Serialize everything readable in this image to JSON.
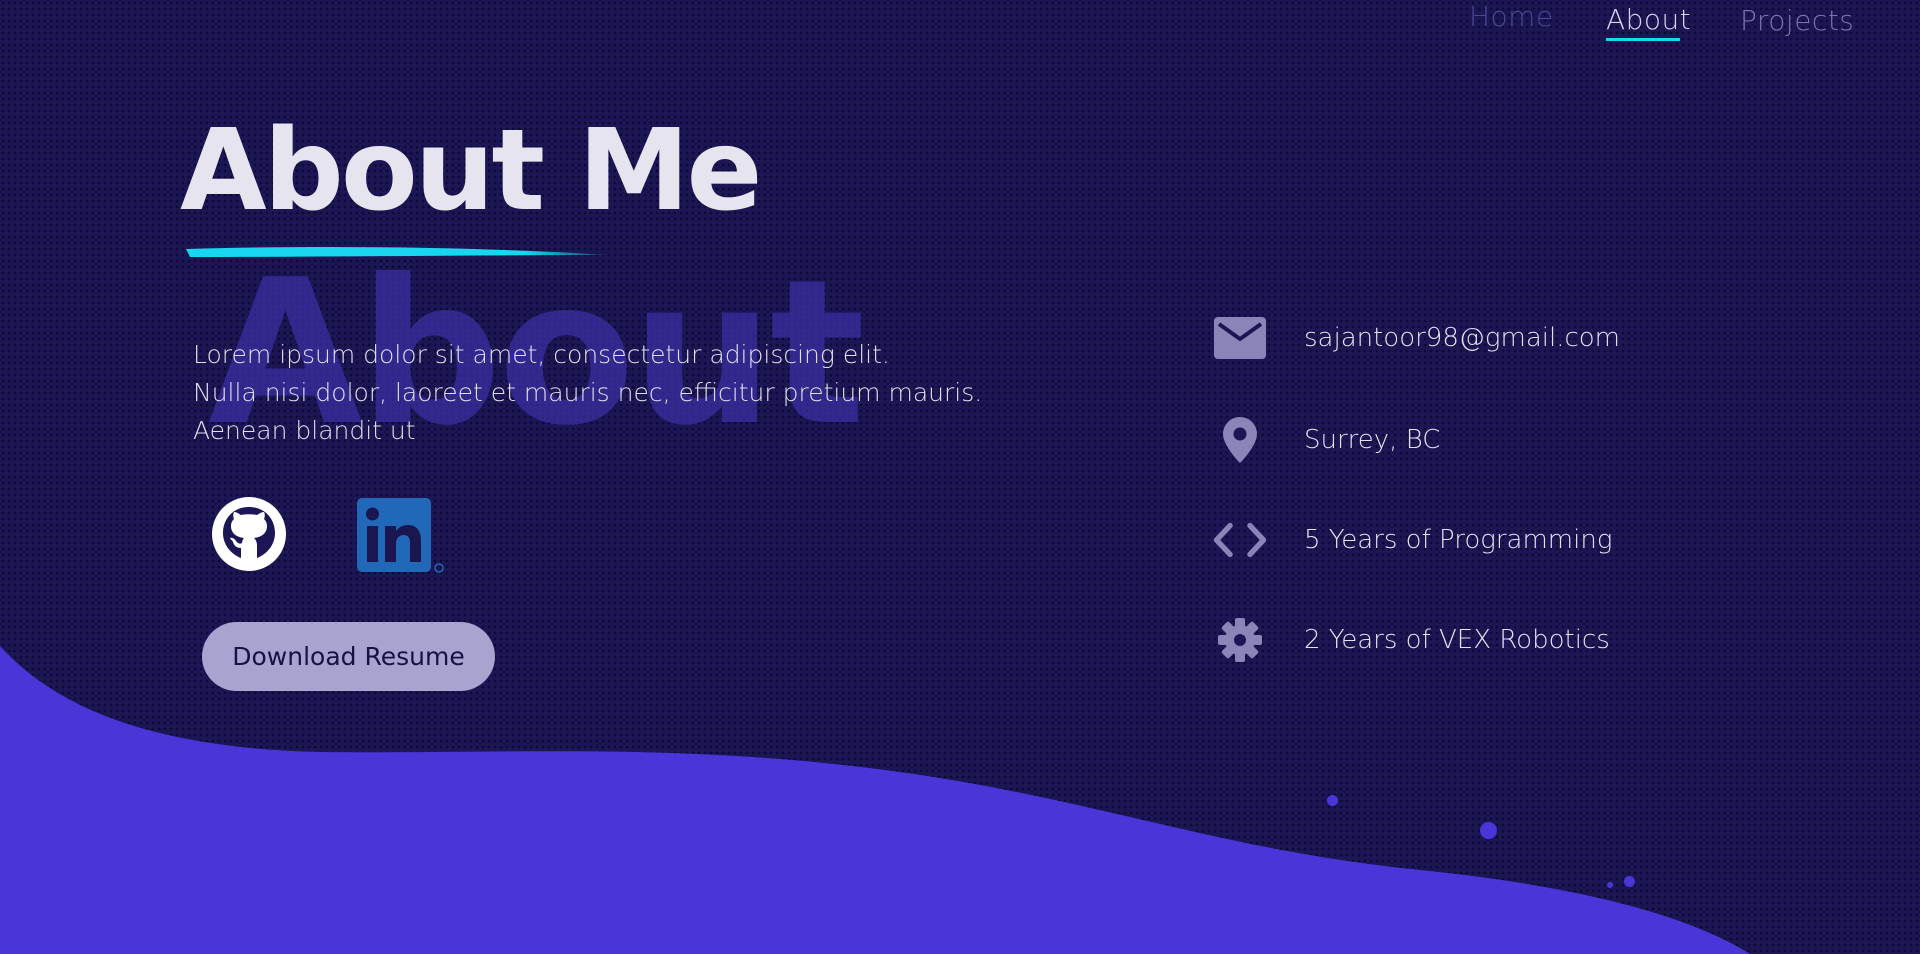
{
  "nav": {
    "items": [
      {
        "label": "Home"
      },
      {
        "label": "About"
      },
      {
        "label": "Projects"
      }
    ],
    "active": "About"
  },
  "hero": {
    "title": "About Me",
    "watermark": "About"
  },
  "bio": {
    "lines": [
      "Lorem ipsum dolor sit amet, consectetur adipiscing elit.",
      "Nulla nisi dolor, laoreet et mauris nec, efficitur pretium mauris.",
      "Aenean blandit ut"
    ]
  },
  "social": {
    "github_icon": "github-icon",
    "linkedin_icon": "linkedin-icon"
  },
  "resume": {
    "button_label": "Download Resume"
  },
  "info": {
    "email": "sajantoor98@gmail.com",
    "location": "Surrey, BC",
    "programming": "5 Years of Programming",
    "vex": "2 Years of VEX Robotics",
    "icons": [
      "mail-icon",
      "location-pin-icon",
      "code-icon",
      "gear-icon"
    ]
  },
  "colors": {
    "background": "#1c1655",
    "wave": "#4a35d8",
    "accent": "#1ad8ef",
    "button": "#a8a3cf",
    "watermark": "#3a2ea0"
  }
}
